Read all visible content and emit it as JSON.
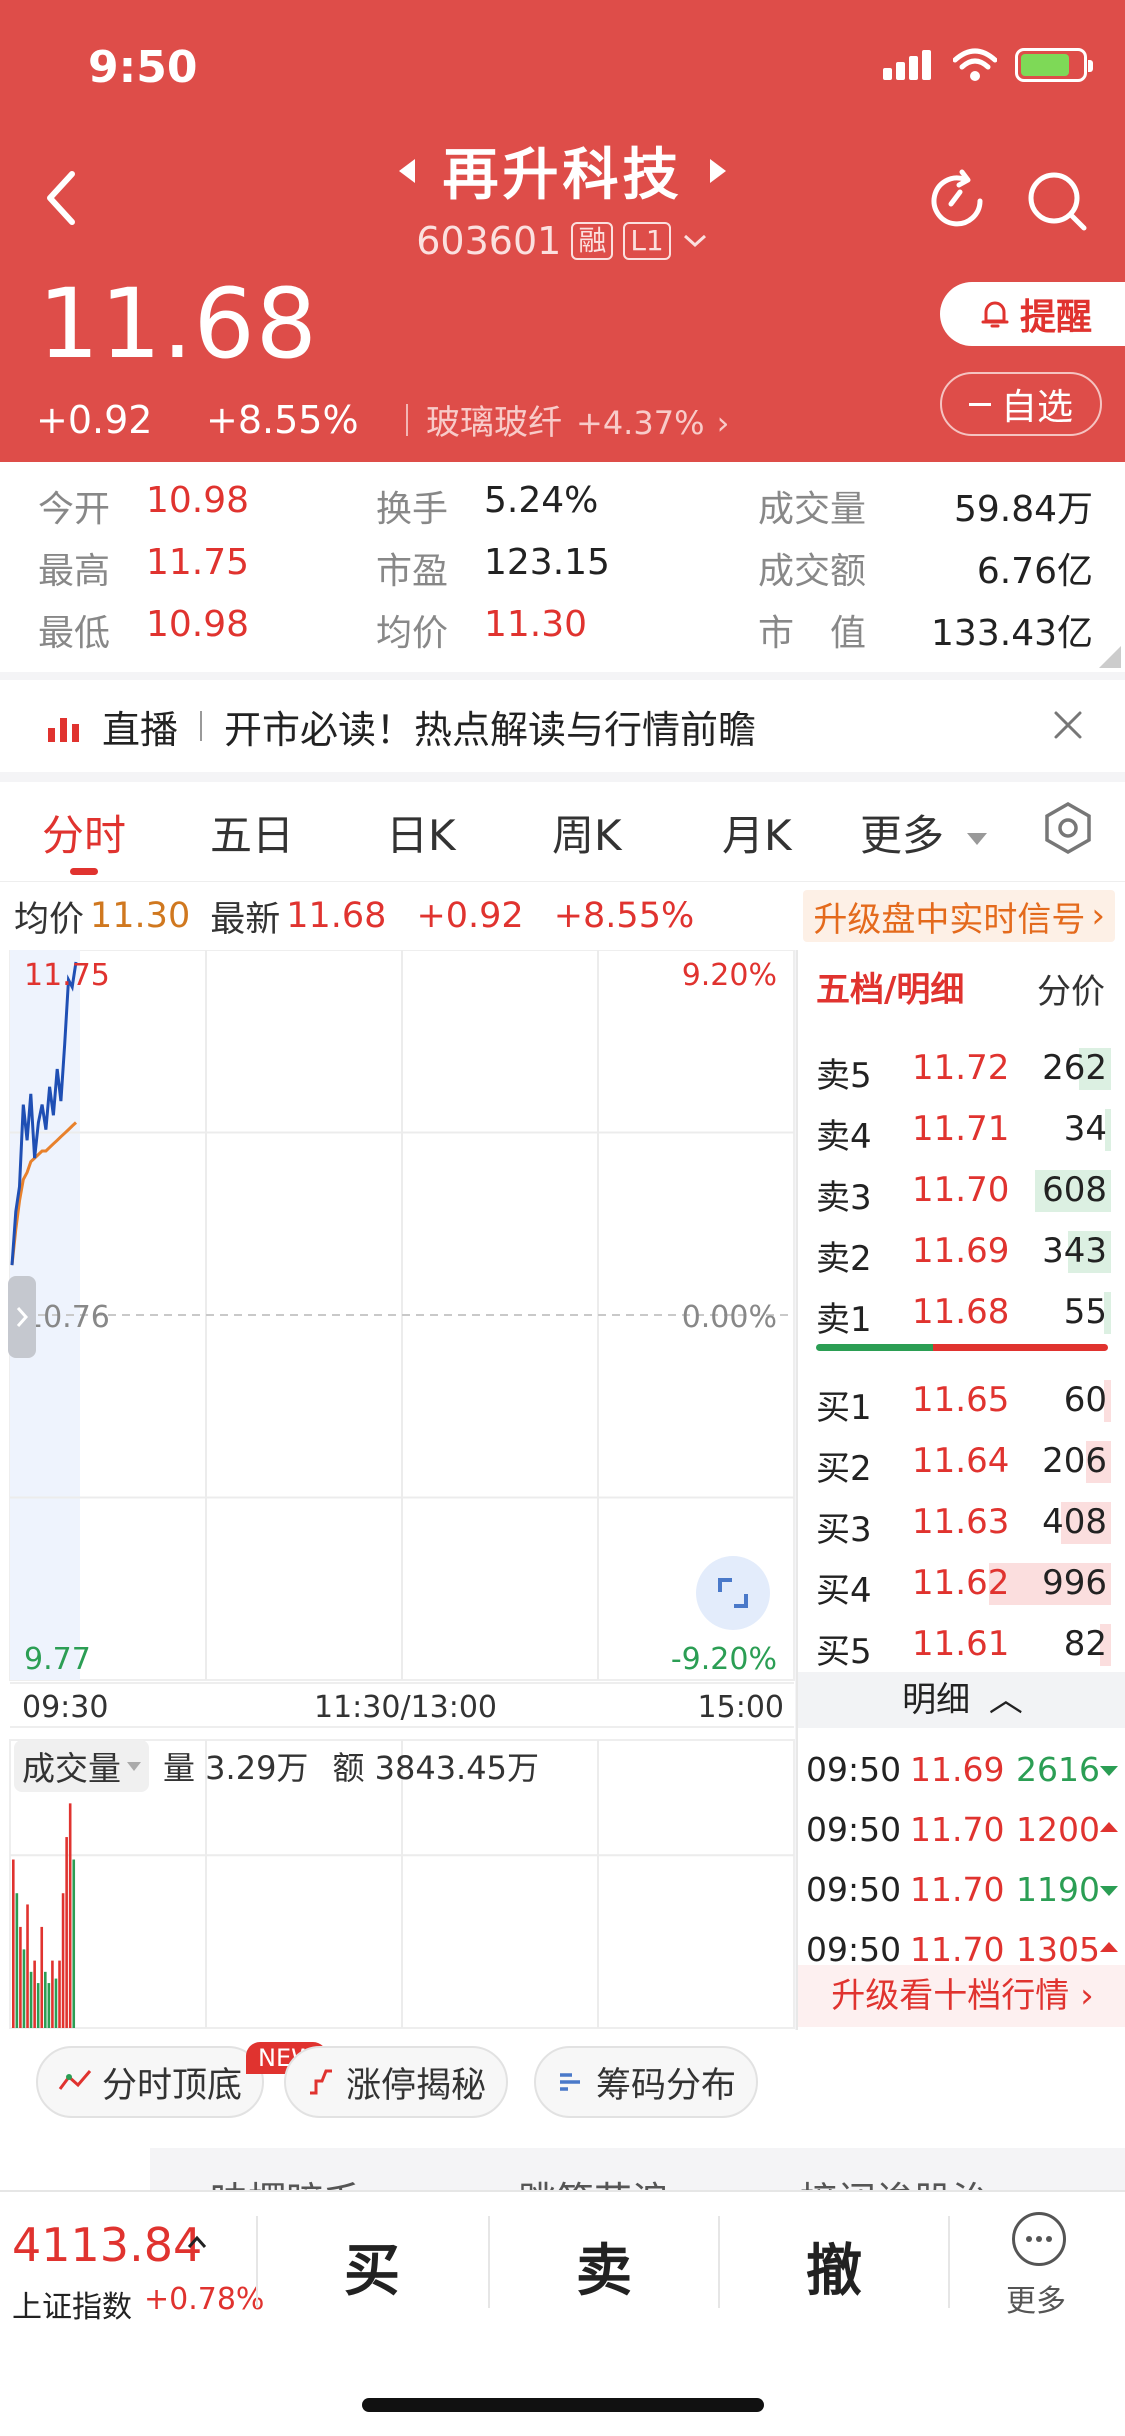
{
  "status": {
    "time": "9:50"
  },
  "stock": {
    "name": "再升科技",
    "code": "603601",
    "tag_margin": "融",
    "tag_level": "L1",
    "price": "11.68",
    "change_abs": "+0.92",
    "change_pct": "+8.55%",
    "sector": "玻璃玻纤",
    "sector_change": "+4.37%",
    "remind_label": "提醒",
    "watch_label": "自选"
  },
  "stats": {
    "open_label": "今开",
    "open": "10.98",
    "high_label": "最高",
    "high": "11.75",
    "low_label": "最低",
    "low": "10.98",
    "turnover_label": "换手",
    "turnover": "5.24%",
    "pe_label": "市盈",
    "pe": "123.15",
    "avg_label": "均价",
    "avg": "11.30",
    "volume_label": "成交量",
    "volume": "59.84万",
    "amount_label": "成交额",
    "amount": "6.76亿",
    "mcap_label": "市　值",
    "mcap": "133.43亿"
  },
  "banner": {
    "label": "直播",
    "text": "开市必读！热点解读与行情前瞻"
  },
  "tabs": [
    "分时",
    "五日",
    "日K",
    "周K",
    "月K",
    "更多"
  ],
  "summary": {
    "avg_label": "均价",
    "avg": "11.30",
    "latest_label": "最新",
    "latest": "11.68",
    "change_abs": "+0.92",
    "change_pct": "+8.55%",
    "upgrade": "升级盘中实时信号"
  },
  "chart": {
    "y_high": "11.75",
    "y_mid": "10.76",
    "y_low": "9.77",
    "pct_high": "9.20%",
    "pct_mid": "0.00%",
    "pct_low": "-9.20%",
    "time_start": "09:30",
    "time_mid": "11:30/13:00",
    "time_end": "15:00",
    "volume_label": "成交量",
    "vol_text": "量 3.29万",
    "amt_text": "额 3843.45万"
  },
  "chart_data": {
    "type": "line",
    "ylim": [
      9.77,
      11.75
    ],
    "series": [],
    "price_line": [
      10.9,
      11.05,
      11.12,
      11.35,
      11.25,
      11.38,
      11.2,
      11.3,
      11.35,
      11.28,
      11.4,
      11.32,
      11.45,
      11.36,
      11.52,
      11.7,
      11.68,
      11.75
    ],
    "avg_line": [
      10.9,
      11.0,
      11.08,
      11.14,
      11.16,
      11.19,
      11.2,
      11.21,
      11.22,
      11.22,
      11.23,
      11.24,
      11.25,
      11.26,
      11.27,
      11.28,
      11.29,
      11.3
    ],
    "volume_bars": [
      0.75,
      0.6,
      0.45,
      0.35,
      0.55,
      0.25,
      0.3,
      0.2,
      0.45,
      0.25,
      0.2,
      0.3,
      0.22,
      0.3,
      0.6,
      0.85,
      1.0,
      0.75
    ],
    "volume_up": [
      true,
      false,
      true,
      false,
      true,
      false,
      true,
      false,
      true,
      false,
      false,
      true,
      false,
      true,
      true,
      true,
      true,
      false
    ]
  },
  "orderbook": {
    "header": "五档/明细",
    "header_right": "分价",
    "asks": [
      {
        "label": "卖5",
        "price": "11.72",
        "vol": "262",
        "w": 0.18
      },
      {
        "label": "卖4",
        "price": "11.71",
        "vol": "34",
        "w": 0.03
      },
      {
        "label": "卖3",
        "price": "11.70",
        "vol": "608",
        "w": 0.42
      },
      {
        "label": "卖2",
        "price": "11.69",
        "vol": "343",
        "w": 0.24
      },
      {
        "label": "卖1",
        "price": "11.68",
        "vol": "55",
        "w": 0.04
      }
    ],
    "bids": [
      {
        "label": "买1",
        "price": "11.65",
        "vol": "60",
        "w": 0.04
      },
      {
        "label": "买2",
        "price": "11.64",
        "vol": "206",
        "w": 0.14
      },
      {
        "label": "买3",
        "price": "11.63",
        "vol": "408",
        "w": 0.28
      },
      {
        "label": "买4",
        "price": "11.62",
        "vol": "996",
        "w": 0.68
      },
      {
        "label": "买5",
        "price": "11.61",
        "vol": "82",
        "w": 0.06
      }
    ],
    "detail_label": "明细",
    "ticks": [
      {
        "time": "09:50",
        "price": "11.69",
        "vol": "2616",
        "dir": "down"
      },
      {
        "time": "09:50",
        "price": "11.70",
        "vol": "1200",
        "dir": "up"
      },
      {
        "time": "09:50",
        "price": "11.70",
        "vol": "1190",
        "dir": "down"
      },
      {
        "time": "09:50",
        "price": "11.70",
        "vol": "1305",
        "dir": "up"
      }
    ],
    "upgrade": "升级看十档行情"
  },
  "features": {
    "chip1": "分时顶底",
    "chip1_badge": "NEW",
    "chip2": "涨停揭秘",
    "chip3": "筹码分布",
    "cut_tab1": "味摆暗毛",
    "cut_tab2": "跳筒花浪",
    "cut_tab3": "接闭诶股治"
  },
  "bottom": {
    "index_value": "4113.84",
    "index_name": "上证指数",
    "index_change": "+0.78%",
    "buy": "买",
    "sell": "卖",
    "cancel": "撤",
    "more": "更多"
  }
}
